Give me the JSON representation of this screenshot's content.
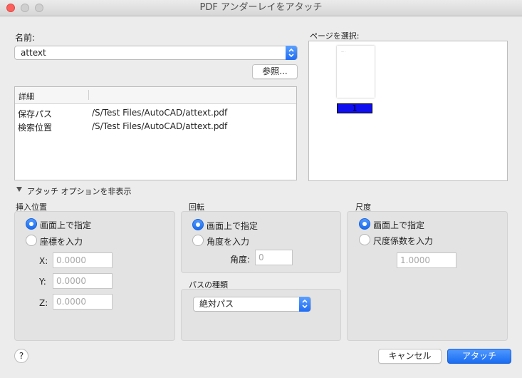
{
  "window": {
    "title": "PDF アンダーレイをアタッチ"
  },
  "name": {
    "label": "名前:",
    "value": "attext"
  },
  "browse": {
    "label": "参照..."
  },
  "details": {
    "header": "詳細",
    "rows": [
      {
        "key": "保存パス",
        "value": "/S/Test Files/AutoCAD/attext.pdf"
      },
      {
        "key": "検索位置",
        "value": "/S/Test Files/AutoCAD/attext.pdf"
      }
    ]
  },
  "page_select": {
    "label": "ページを選択:",
    "page_number": "1"
  },
  "options_toggle": {
    "label": "アタッチ オプションを非表示"
  },
  "insert": {
    "title": "挿入位置",
    "radio_screen": "画面上で指定",
    "radio_coords": "座標を入力",
    "x_label": "X:",
    "x_value": "0.0000",
    "y_label": "Y:",
    "y_value": "0.0000",
    "z_label": "Z:",
    "z_value": "0.0000"
  },
  "rotation": {
    "title": "回転",
    "radio_screen": "画面上で指定",
    "radio_angle": "角度を入力",
    "angle_label": "角度:",
    "angle_value": "0"
  },
  "path_type": {
    "title": "パスの種類",
    "value": "絶対パス"
  },
  "scale": {
    "title": "尺度",
    "radio_screen": "画面上で指定",
    "radio_factor": "尺度係数を入力",
    "factor_value": "1.0000"
  },
  "footer": {
    "help": "?",
    "cancel": "キャンセル",
    "attach": "アタッチ"
  },
  "colors": {
    "accent": "#1a6cf1",
    "page_highlight": "#1010ee"
  }
}
